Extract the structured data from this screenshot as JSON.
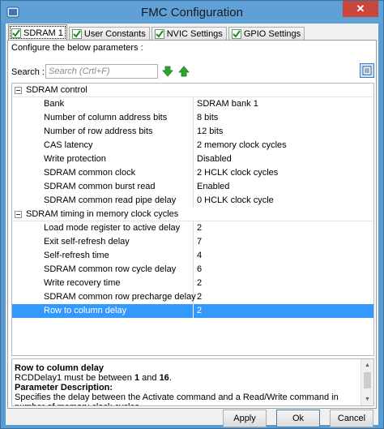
{
  "window": {
    "title": "FMC Configuration",
    "close_glyph": "✕"
  },
  "tabs": [
    {
      "label": "SDRAM 1"
    },
    {
      "label": "User Constants"
    },
    {
      "label": "NVIC Settings"
    },
    {
      "label": "GPIO Settings"
    }
  ],
  "configure_label": "Configure the below parameters :",
  "search": {
    "label": "Search :",
    "placeholder": "Search (Crtl+F)"
  },
  "groups": [
    {
      "label": "SDRAM control",
      "params": [
        {
          "name": "Bank",
          "value": "SDRAM bank 1"
        },
        {
          "name": "Number of column address bits",
          "value": "8 bits"
        },
        {
          "name": "Number of row address bits",
          "value": "12 bits"
        },
        {
          "name": "CAS latency",
          "value": "2 memory clock cycles"
        },
        {
          "name": "Write protection",
          "value": "Disabled"
        },
        {
          "name": "SDRAM common clock",
          "value": "2 HCLK clock cycles"
        },
        {
          "name": "SDRAM common burst read",
          "value": "Enabled"
        },
        {
          "name": "SDRAM common read pipe delay",
          "value": "0 HCLK clock cycle"
        }
      ]
    },
    {
      "label": "SDRAM timing in memory clock cycles",
      "params": [
        {
          "name": "Load mode register to active delay",
          "value": "2"
        },
        {
          "name": "Exit self-refresh delay",
          "value": "7"
        },
        {
          "name": "Self-refresh time",
          "value": "4"
        },
        {
          "name": "SDRAM common row cycle delay",
          "value": "6"
        },
        {
          "name": "Write recovery time",
          "value": "2"
        },
        {
          "name": "SDRAM common row precharge delay",
          "value": "2"
        },
        {
          "name": "Row to column delay",
          "value": "2"
        }
      ]
    }
  ],
  "description": {
    "title": "Row to column delay",
    "line1_prefix": "RCDDelay1 must be between ",
    "min": "1",
    "line1_mid": " and ",
    "max": "16",
    "line1_suffix": ".",
    "param_heading": "Parameter Description:",
    "text": "Specifies the delay between the Activate command and a Read/Write command in number of memory clock cycles."
  },
  "buttons": {
    "apply": "Apply",
    "ok": "Ok",
    "cancel": "Cancel"
  },
  "colors": {
    "selection": "#3399ff",
    "titlebar": "#5fa0d6",
    "close": "#c9463d",
    "arrows": "#2fa52f"
  }
}
